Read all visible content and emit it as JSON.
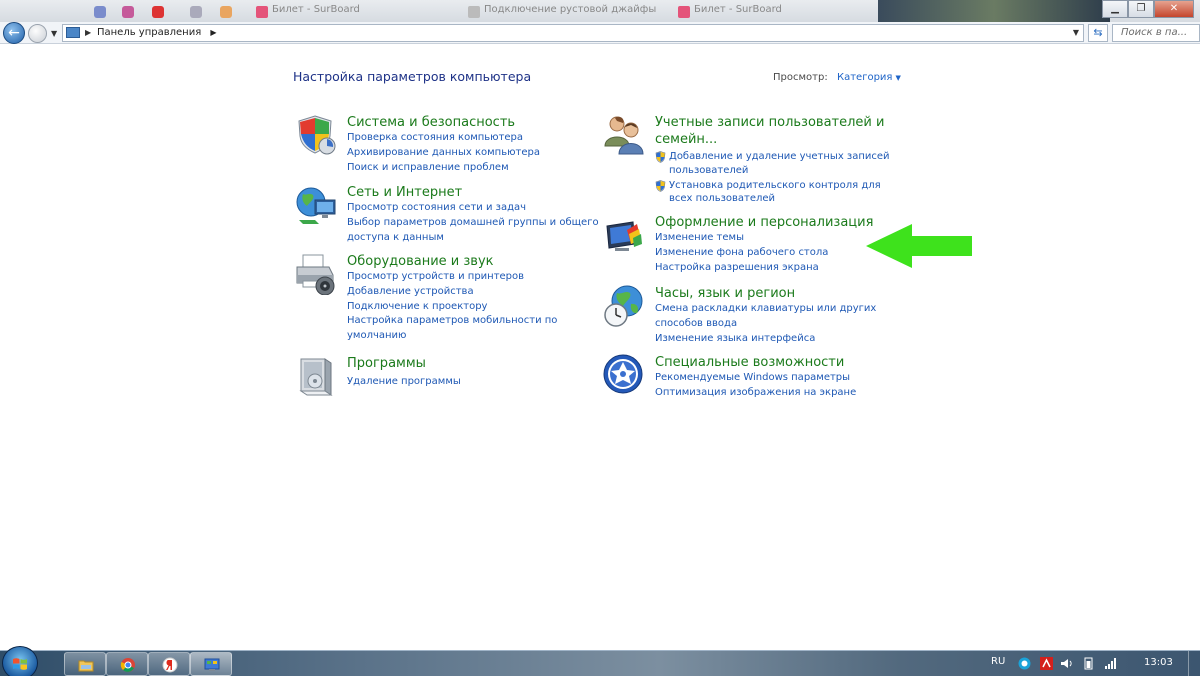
{
  "window": {
    "breadcrumb_root": "Панель управления",
    "search_placeholder": "Поиск в па..."
  },
  "background_tabs": [
    {
      "label": "Билет - SurBoard",
      "color": "#e4547a"
    },
    {
      "label": "Подключение рустовой джайфы",
      "color": "#999999"
    },
    {
      "label": "Билет - SurBoard",
      "color": "#e4547a"
    }
  ],
  "header": {
    "title": "Настройка параметров компьютера",
    "view_label": "Просмотр:",
    "view_value": "Категория"
  },
  "categories_left": [
    {
      "icon": "security-shield-icon",
      "title": "Система и безопасность",
      "links": [
        "Проверка состояния компьютера",
        "Архивирование данных компьютера",
        "Поиск и исправление проблем"
      ]
    },
    {
      "icon": "network-globe-icon",
      "title": "Сеть и Интернет",
      "links": [
        "Просмотр состояния сети и задач",
        "Выбор параметров домашней группы и общего",
        "доступа к данным"
      ]
    },
    {
      "icon": "printer-icon",
      "title": "Оборудование и звук",
      "links": [
        "Просмотр устройств и принтеров",
        "Добавление устройства",
        "Подключение к проектору",
        "Настройка параметров мобильности по",
        "умолчанию"
      ]
    },
    {
      "icon": "programs-box-icon",
      "title": "Программы",
      "links": [
        "Удаление программы"
      ]
    }
  ],
  "categories_right": [
    {
      "icon": "users-icon",
      "title": "Учетные записи пользователей и семейн...",
      "links": [
        "Добавление и удаление учетных записей пользователей",
        "Установка родительского контроля для всех пользователей"
      ]
    },
    {
      "icon": "personalization-icon",
      "title": "Оформление и персонализация",
      "links": [
        "Изменение темы",
        "Изменение фона рабочего стола",
        "Настройка разрешения экрана"
      ]
    },
    {
      "icon": "clock-globe-icon",
      "title": "Часы, язык и регион",
      "links": [
        "Смена раскладки клавиатуры или других",
        "способов ввода",
        "Изменение языка интерфейса"
      ]
    },
    {
      "icon": "accessibility-icon",
      "title": "Специальные возможности",
      "links": [
        "Рекомендуемые Windows параметры",
        "Оптимизация изображения на экране"
      ]
    }
  ],
  "annotation": {
    "arrow_color": "#3ee21c"
  },
  "taskbar": {
    "language": "RU",
    "time": "13:03"
  }
}
